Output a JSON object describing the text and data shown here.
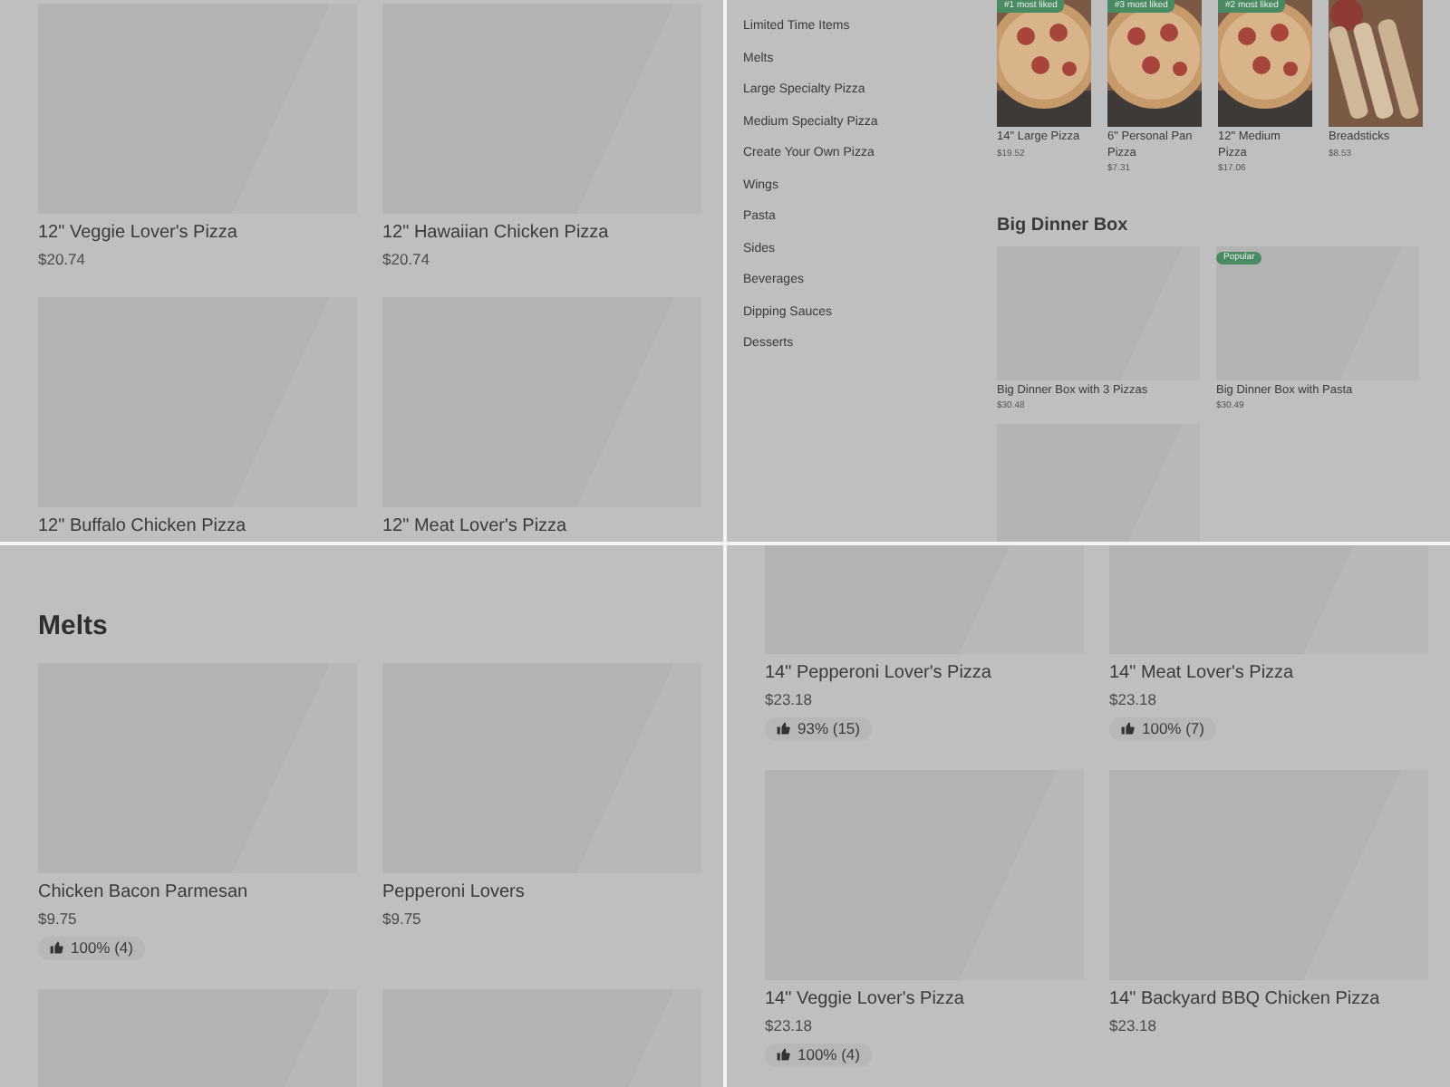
{
  "top_left": {
    "items": [
      {
        "name": "12\" Veggie Lover's Pizza",
        "price": "$20.74"
      },
      {
        "name": "12\" Hawaiian Chicken Pizza",
        "price": "$20.74"
      },
      {
        "name": "12\" Buffalo Chicken Pizza"
      },
      {
        "name": "12\" Meat Lover's Pizza"
      }
    ]
  },
  "top_right": {
    "categories": [
      "Limited Time Items",
      "Melts",
      "Large Specialty Pizza",
      "Medium Specialty Pizza",
      "Create Your Own Pizza",
      "Wings",
      "Pasta",
      "Sides",
      "Beverages",
      "Dipping Sauces",
      "Desserts"
    ],
    "featured": [
      {
        "name": "14\" Large Pizza",
        "price": "$19.52",
        "badge": "#1 most liked"
      },
      {
        "name": "6\" Personal Pan Pizza",
        "price": "$7.31",
        "badge": "#3 most liked"
      },
      {
        "name": "12\" Medium Pizza",
        "price": "$17.06",
        "badge": "#2 most liked"
      },
      {
        "name": "Breadsticks",
        "price": "$8.53"
      }
    ],
    "section": {
      "title": "Big Dinner Box",
      "items": [
        {
          "name": "Big Dinner Box with 3 Pizzas",
          "price": "$30.48"
        },
        {
          "name": "Big Dinner Box with Pasta",
          "price": "$30.49",
          "badge": "Popular"
        },
        {
          "kind": "placeholder"
        }
      ]
    }
  },
  "bottom_left": {
    "title": "Melts",
    "items": [
      {
        "name": "Chicken Bacon Parmesan",
        "price": "$9.75",
        "rating": "100% (4)"
      },
      {
        "name": "Pepperoni Lovers",
        "price": "$9.75"
      },
      {
        "kind": "placeholder"
      },
      {
        "kind": "placeholder"
      }
    ]
  },
  "bottom_right": {
    "items": [
      {
        "name": "14\" Pepperoni Lover's Pizza",
        "price": "$23.18",
        "rating": "93% (15)"
      },
      {
        "name": "14\" Meat Lover's Pizza",
        "price": "$23.18",
        "rating": "100% (7)"
      },
      {
        "name": "14\" Veggie Lover's Pizza",
        "price": "$23.18",
        "rating": "100% (4)"
      },
      {
        "name": "14\" Backyard BBQ Chicken Pizza",
        "price": "$23.18"
      }
    ]
  }
}
